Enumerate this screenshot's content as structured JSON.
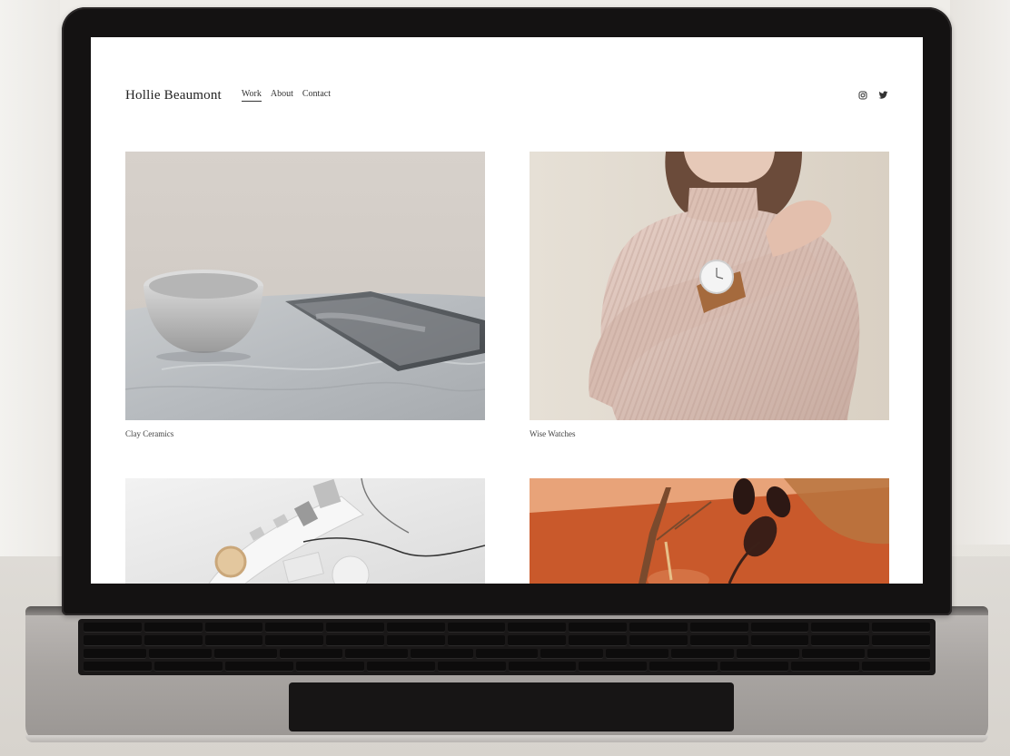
{
  "site": {
    "brand": "Hollie Beaumont",
    "nav": [
      {
        "label": "Work",
        "active": true
      },
      {
        "label": "About",
        "active": false
      },
      {
        "label": "Contact",
        "active": false
      }
    ],
    "social_icons": [
      "instagram-icon",
      "twitter-icon"
    ]
  },
  "gallery": {
    "items": [
      {
        "caption": "Clay Ceramics",
        "image": "bowl-and-tray-photo"
      },
      {
        "caption": "Wise Watches",
        "image": "woman-with-watch-photo"
      },
      {
        "caption": "",
        "image": "tech-accessories-photo"
      },
      {
        "caption": "",
        "image": "orange-still-life-photo"
      }
    ]
  },
  "colors": {
    "page_background": "#ffffff",
    "text": "#222222",
    "laptop_bezel": "#141212",
    "laptop_body": "#a9a5a2",
    "accent_orange": "#c9592b"
  }
}
